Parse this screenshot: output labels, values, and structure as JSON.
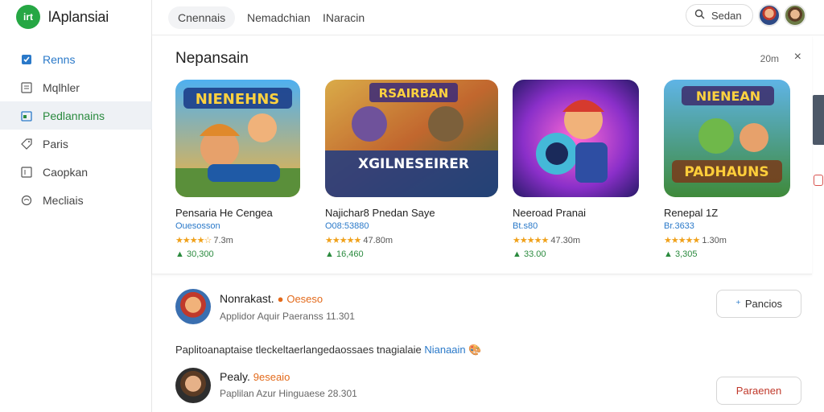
{
  "app": {
    "logo_text": "irt",
    "name": "lAplansiai"
  },
  "sidebar": {
    "items": [
      {
        "label": "Renns",
        "icon": "bookmark-icon"
      },
      {
        "label": "Mqlhler",
        "icon": "list-icon"
      },
      {
        "label": "Pedlannains",
        "icon": "calendar-icon"
      },
      {
        "label": "Paris",
        "icon": "tag-icon"
      },
      {
        "label": "Caopkan",
        "icon": "box-icon"
      },
      {
        "label": "Mecliais",
        "icon": "globe-icon"
      }
    ]
  },
  "topbar": {
    "tabs": [
      "Cnennais",
      "Nemadchian",
      "INaracin"
    ],
    "search_label": "Sedan"
  },
  "panel": {
    "title": "Nepansain",
    "meta": "20m",
    "close": "×",
    "cards": [
      {
        "name": "Pensaria He Cengea",
        "sub": "Ouesosson",
        "stars": "★★★★☆",
        "rating": "7.3m",
        "count": "30,300"
      },
      {
        "name": "Najichar8 Pnedan Saye",
        "sub": "O08:53880",
        "stars": "★★★★★",
        "rating": "47.80m",
        "count": "16,460"
      },
      {
        "name": "Neeroad Pranai",
        "sub": "Bt.s80",
        "stars": "★★★★★",
        "rating": "47.30m",
        "count": "33.00"
      },
      {
        "name": "Renepal 1Z",
        "sub": "Br.3633",
        "stars": "★★★★★",
        "rating": "1.30m",
        "count": "3,305"
      }
    ],
    "thumb_texts": [
      "NIENEHNS",
      "RSAIRBAN",
      "",
      "NIENEAN"
    ],
    "thumb_texts_2": [
      "",
      "XGILNESEIRER",
      "",
      "PADHAUNS"
    ]
  },
  "list": {
    "rows": [
      {
        "title": "Nonrakast.",
        "badge": "Oeseso",
        "sub": "Applidor Aquir Paeranss",
        "sub_num": "11.301",
        "button": "Pancios",
        "button_icon": "sparkle-icon"
      },
      {
        "title": "Pealy.",
        "badge": "9eseaio",
        "sub": "Paplilan Azur Hinguaese",
        "sub_num": "28.301",
        "button": "Paraenen",
        "button_icon": ""
      }
    ],
    "description": "Paplitoanaptaise tleckeltaerlangedaossaes tnagialaie",
    "description_link": "Nianaain"
  },
  "colors": {
    "accent_green": "#26a744",
    "link_blue": "#2a79c9",
    "star_gold": "#f0a11b",
    "badge_orange": "#e36a1b"
  }
}
